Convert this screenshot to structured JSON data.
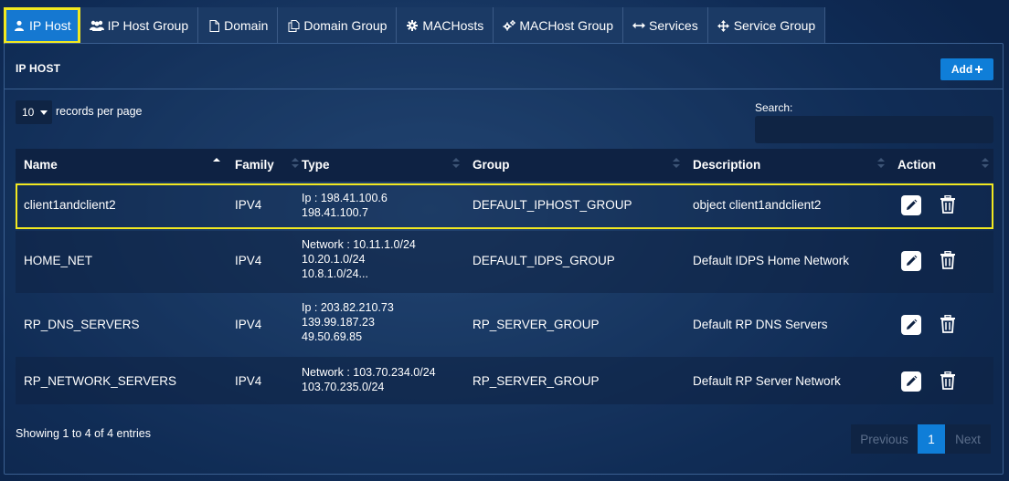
{
  "tabs": [
    {
      "label": "IP Host",
      "icon": "user-icon"
    },
    {
      "label": "IP Host Group",
      "icon": "users-icon"
    },
    {
      "label": "Domain",
      "icon": "file-icon"
    },
    {
      "label": "Domain Group",
      "icon": "files-icon"
    },
    {
      "label": "MACHosts",
      "icon": "cog-icon"
    },
    {
      "label": "MACHost Group",
      "icon": "cogs-icon"
    },
    {
      "label": "Services",
      "icon": "arrows-h-icon"
    },
    {
      "label": "Service Group",
      "icon": "arrows-icon"
    }
  ],
  "panel": {
    "title": "IP HOST",
    "add_label": "Add",
    "length_value": "10",
    "length_label": "records per page",
    "search_label": "Search:",
    "search_value": ""
  },
  "table": {
    "columns": [
      "Name",
      "Family",
      "Type",
      "Group",
      "Description",
      "Action"
    ],
    "rows": [
      {
        "name": "client1andclient2",
        "family": "IPV4",
        "type_lines": [
          "Ip : 198.41.100.6",
          "198.41.100.7"
        ],
        "group": "DEFAULT_IPHOST_GROUP",
        "description": "object client1andclient2"
      },
      {
        "name": "HOME_NET",
        "family": "IPV4",
        "type_lines": [
          "Network : 10.11.1.0/24",
          "10.20.1.0/24",
          "10.8.1.0/24..."
        ],
        "group": "DEFAULT_IDPS_GROUP",
        "description": "Default IDPS Home Network"
      },
      {
        "name": "RP_DNS_SERVERS",
        "family": "IPV4",
        "type_lines": [
          "Ip : 203.82.210.73",
          "139.99.187.23",
          "49.50.69.85"
        ],
        "group": "RP_SERVER_GROUP",
        "description": "Default RP DNS Servers"
      },
      {
        "name": "RP_NETWORK_SERVERS",
        "family": "IPV4",
        "type_lines": [
          "Network : 103.70.234.0/24",
          "103.70.235.0/24"
        ],
        "group": "RP_SERVER_GROUP",
        "description": "Default RP Server Network"
      }
    ]
  },
  "footer": {
    "info": "Showing 1 to 4 of 4 entries",
    "previous": "Previous",
    "page": "1",
    "next": "Next"
  },
  "colors": {
    "accent": "#0f7ed8",
    "highlight": "#f1e820",
    "background": "#0d2a52"
  }
}
